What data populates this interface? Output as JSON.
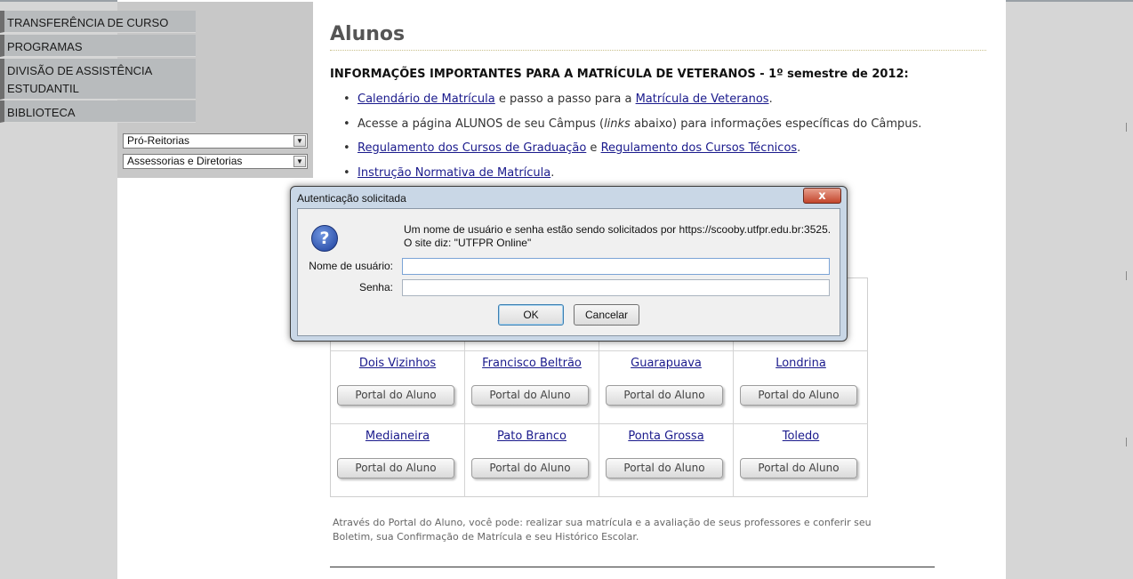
{
  "sidebar": {
    "items": [
      {
        "label": "TRANSFERÊNCIA DE CURSO"
      },
      {
        "label": "PROGRAMAS"
      },
      {
        "label": "DIVISÃO DE ASSISTÊNCIA ESTUDANTIL"
      },
      {
        "label": "BIBLIOTECA"
      }
    ],
    "selects": [
      {
        "value": "Pró-Reitorias"
      },
      {
        "value": "Assessorias e Diretorias"
      }
    ]
  },
  "main": {
    "title": "Alunos",
    "info_heading": "INFORMAÇÕES IMPORTANTES PARA A MATRÍCULA DE VETERANOS - 1º semestre de 2012:",
    "bullets": [
      {
        "link1": "Calendário de Matrícula",
        "text1": " e passo a passo para a ",
        "link2": "Matrícula de Veteranos",
        "text2": "."
      },
      {
        "text_a": "Acesse a página ALUNOS de seu Câmpus (",
        "italic": "links",
        "text_b": " abaixo) para informações específicas do Câmpus."
      },
      {
        "link1": "Regulamento dos Cursos de Graduação",
        "text1": " e ",
        "link2": "Regulamento dos Cursos Técnicos",
        "text2": "."
      },
      {
        "link1": "Instrução Normativa de Matrícula",
        "text1": "."
      }
    ],
    "campus_rows": [
      [
        {
          "name": "Dois Vizinhos",
          "button": "Portal do Aluno"
        },
        {
          "name": "Francisco Beltrão",
          "button": "Portal do Aluno"
        },
        {
          "name": "Guarapuava",
          "button": "Portal do Aluno"
        },
        {
          "name": "Londrina",
          "button": "Portal do Aluno"
        }
      ],
      [
        {
          "name": "Medianeira",
          "button": "Portal do Aluno"
        },
        {
          "name": "Pato Branco",
          "button": "Portal do Aluno"
        },
        {
          "name": "Ponta Grossa",
          "button": "Portal do Aluno"
        },
        {
          "name": "Toledo",
          "button": "Portal do Aluno"
        }
      ]
    ],
    "footer_note": "Através do Portal do Aluno, você pode: realizar sua matrícula e a avaliação de seus professores e conferir seu Boletim, sua Confirmação de Matrícula e seu Histórico Escolar."
  },
  "dialog": {
    "title": "Autenticação solicitada",
    "close_glyph": "x",
    "message_line1": "Um nome de usuário e senha estão sendo solicitados por https://scooby.utfpr.edu.br:3525.",
    "message_line2": "O site diz: \"UTFPR Online\"",
    "username_label": "Nome de usuário:",
    "username_value": "",
    "password_label": "Senha:",
    "password_value": "",
    "ok_label": "OK",
    "cancel_label": "Cancelar",
    "icon": "question-icon"
  }
}
